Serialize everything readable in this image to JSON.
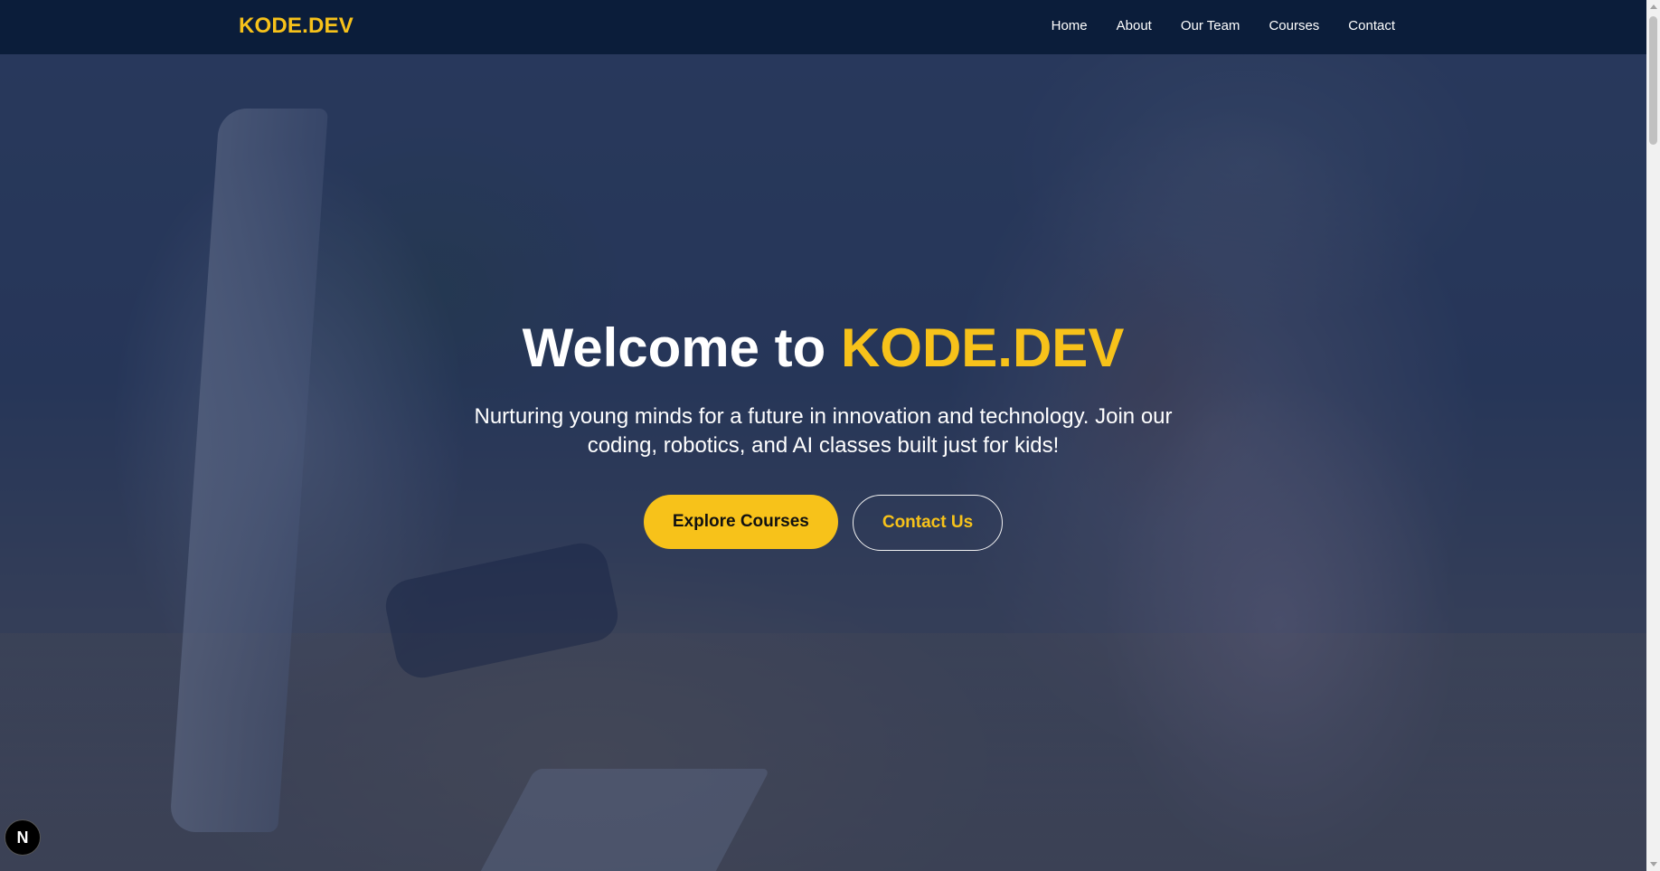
{
  "brand": {
    "name": "KODE.DEV",
    "accent_color": "#f7c21a",
    "nav_bg": "#0b1d3a"
  },
  "nav": {
    "items": [
      {
        "label": "Home"
      },
      {
        "label": "About"
      },
      {
        "label": "Our Team"
      },
      {
        "label": "Courses"
      },
      {
        "label": "Contact"
      }
    ]
  },
  "hero": {
    "title_prefix": "Welcome to",
    "title_accent": "KODE.DEV",
    "subtitle": "Nurturing young minds for a future in innovation and technology. Join our coding, robotics, and AI classes built just for kids!",
    "primary_button": "Explore Courses",
    "secondary_button": "Contact Us",
    "background_image": "photo-of-girl-at-desk-with-computer"
  },
  "badge": {
    "label": "N",
    "icon": "nextjs-badge-icon"
  }
}
